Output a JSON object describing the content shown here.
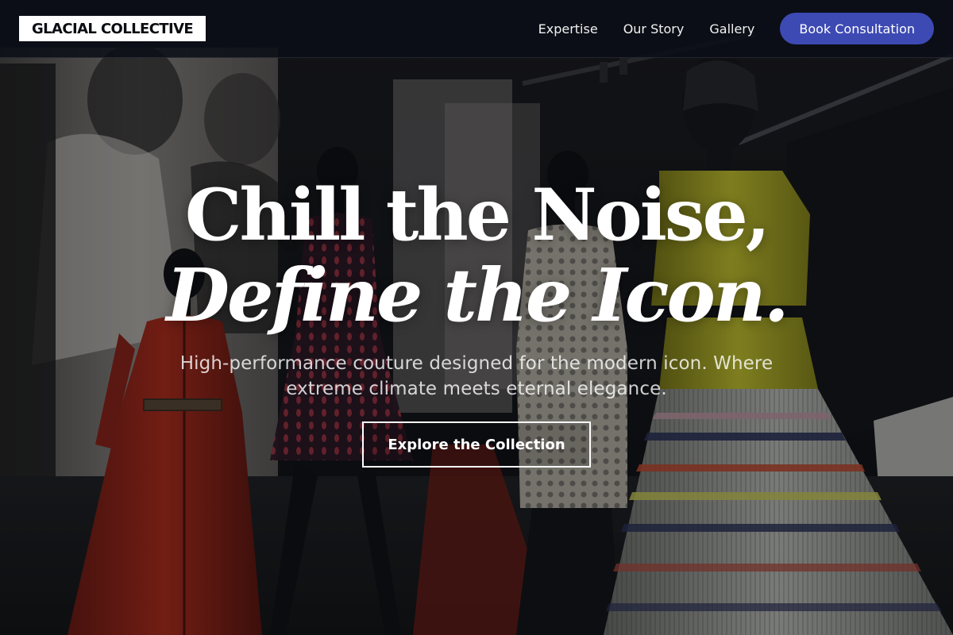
{
  "brand": {
    "name": "GLACIAL COLLECTIVE"
  },
  "nav": {
    "links": [
      {
        "label": "Expertise"
      },
      {
        "label": "Our Story"
      },
      {
        "label": "Gallery"
      }
    ],
    "cta_label": "Book Consultation",
    "cta_color": "#3d4ab3"
  },
  "hero": {
    "headline_line1": "Chill the Noise,",
    "headline_line2": "Define the Icon.",
    "subtext": "High-performance couture designed for the modern icon. Where extreme climate meets eternal elegance.",
    "cta_label": "Explore the Collection",
    "background": "fashion-exhibit-mannequins-image"
  }
}
